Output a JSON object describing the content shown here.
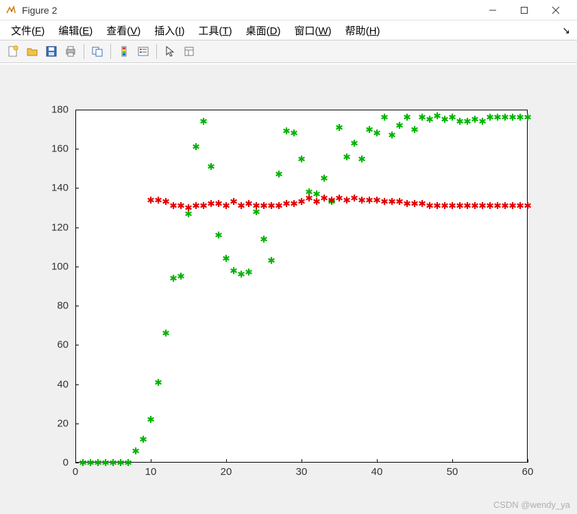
{
  "window": {
    "title": "Figure 2",
    "minimize_tooltip": "Minimize",
    "maximize_tooltip": "Maximize",
    "close_tooltip": "Close"
  },
  "menu": {
    "items": [
      {
        "label": "文件",
        "mnemonic": "F"
      },
      {
        "label": "编辑",
        "mnemonic": "E"
      },
      {
        "label": "查看",
        "mnemonic": "V"
      },
      {
        "label": "插入",
        "mnemonic": "I"
      },
      {
        "label": "工具",
        "mnemonic": "T"
      },
      {
        "label": "桌面",
        "mnemonic": "D"
      },
      {
        "label": "窗口",
        "mnemonic": "W"
      },
      {
        "label": "帮助",
        "mnemonic": "H"
      }
    ]
  },
  "toolbar": {
    "new": "New Figure",
    "open": "Open",
    "save": "Save",
    "print": "Print",
    "link": "Link/Dock",
    "colorbar": "Insert Colorbar",
    "legend": "Insert Legend",
    "cursor": "Edit Plot",
    "properties": "Open Property Inspector"
  },
  "watermark": "CSDN @wendy_ya",
  "chart_data": {
    "type": "scatter",
    "xlim": [
      0,
      60
    ],
    "ylim": [
      0,
      180
    ],
    "xticks": [
      0,
      10,
      20,
      30,
      40,
      50,
      60
    ],
    "yticks": [
      0,
      20,
      40,
      60,
      80,
      100,
      120,
      140,
      160,
      180
    ],
    "xlabel": "",
    "ylabel": "",
    "title": "",
    "series": [
      {
        "name": "green",
        "marker": "*",
        "color": "#00b400",
        "x": [
          1,
          2,
          3,
          4,
          5,
          6,
          7,
          8,
          9,
          10,
          11,
          12,
          13,
          14,
          15,
          16,
          17,
          18,
          19,
          20,
          21,
          22,
          23,
          24,
          25,
          26,
          27,
          28,
          29,
          30,
          31,
          32,
          33,
          34,
          35,
          36,
          37,
          38,
          39,
          40,
          41,
          42,
          43,
          44,
          45,
          46,
          47,
          48,
          49,
          50,
          51,
          52,
          53,
          54,
          55,
          56,
          57,
          58,
          59,
          60
        ],
        "y": [
          0,
          0,
          0,
          0,
          0,
          0,
          0,
          6,
          12,
          22,
          41,
          66,
          94,
          95,
          127,
          161,
          174,
          151,
          116,
          104,
          98,
          96,
          97,
          128,
          114,
          103,
          147,
          169,
          168,
          155,
          138,
          137,
          145,
          133,
          171,
          156,
          163,
          155,
          170,
          168,
          176,
          167,
          172,
          176,
          170,
          176,
          175,
          177,
          175,
          176,
          174,
          174,
          175,
          174,
          176,
          176,
          176,
          176,
          176,
          176
        ]
      },
      {
        "name": "red",
        "marker": "*",
        "color": "#e00000",
        "x": [
          10,
          11,
          12,
          13,
          14,
          15,
          16,
          17,
          18,
          19,
          20,
          21,
          22,
          23,
          24,
          25,
          26,
          27,
          28,
          29,
          30,
          31,
          32,
          33,
          34,
          35,
          36,
          37,
          38,
          39,
          40,
          41,
          42,
          43,
          44,
          45,
          46,
          47,
          48,
          49,
          50,
          51,
          52,
          53,
          54,
          55,
          56,
          57,
          58,
          59,
          60
        ],
        "y": [
          134,
          134,
          133,
          131,
          131,
          130,
          131,
          131,
          132,
          132,
          131,
          133,
          131,
          132,
          131,
          131,
          131,
          131,
          132,
          132,
          133,
          135,
          133,
          135,
          134,
          135,
          134,
          135,
          134,
          134,
          134,
          133,
          133,
          133,
          132,
          132,
          132,
          131,
          131,
          131,
          131,
          131,
          131,
          131,
          131,
          131,
          131,
          131,
          131,
          131,
          131
        ]
      }
    ]
  }
}
